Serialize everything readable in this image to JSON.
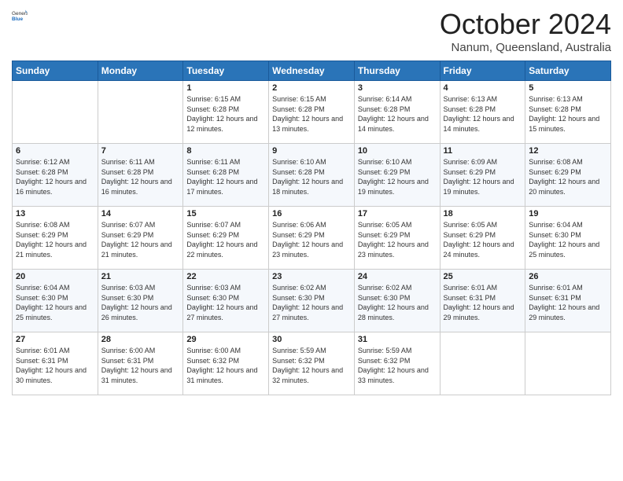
{
  "logo": {
    "general": "General",
    "blue": "Blue"
  },
  "title": "October 2024",
  "location": "Nanum, Queensland, Australia",
  "days_of_week": [
    "Sunday",
    "Monday",
    "Tuesday",
    "Wednesday",
    "Thursday",
    "Friday",
    "Saturday"
  ],
  "weeks": [
    [
      {
        "day": "",
        "info": ""
      },
      {
        "day": "",
        "info": ""
      },
      {
        "day": "1",
        "info": "Sunrise: 6:15 AM\nSunset: 6:28 PM\nDaylight: 12 hours and 12 minutes."
      },
      {
        "day": "2",
        "info": "Sunrise: 6:15 AM\nSunset: 6:28 PM\nDaylight: 12 hours and 13 minutes."
      },
      {
        "day": "3",
        "info": "Sunrise: 6:14 AM\nSunset: 6:28 PM\nDaylight: 12 hours and 14 minutes."
      },
      {
        "day": "4",
        "info": "Sunrise: 6:13 AM\nSunset: 6:28 PM\nDaylight: 12 hours and 14 minutes."
      },
      {
        "day": "5",
        "info": "Sunrise: 6:13 AM\nSunset: 6:28 PM\nDaylight: 12 hours and 15 minutes."
      }
    ],
    [
      {
        "day": "6",
        "info": "Sunrise: 6:12 AM\nSunset: 6:28 PM\nDaylight: 12 hours and 16 minutes."
      },
      {
        "day": "7",
        "info": "Sunrise: 6:11 AM\nSunset: 6:28 PM\nDaylight: 12 hours and 16 minutes."
      },
      {
        "day": "8",
        "info": "Sunrise: 6:11 AM\nSunset: 6:28 PM\nDaylight: 12 hours and 17 minutes."
      },
      {
        "day": "9",
        "info": "Sunrise: 6:10 AM\nSunset: 6:28 PM\nDaylight: 12 hours and 18 minutes."
      },
      {
        "day": "10",
        "info": "Sunrise: 6:10 AM\nSunset: 6:29 PM\nDaylight: 12 hours and 19 minutes."
      },
      {
        "day": "11",
        "info": "Sunrise: 6:09 AM\nSunset: 6:29 PM\nDaylight: 12 hours and 19 minutes."
      },
      {
        "day": "12",
        "info": "Sunrise: 6:08 AM\nSunset: 6:29 PM\nDaylight: 12 hours and 20 minutes."
      }
    ],
    [
      {
        "day": "13",
        "info": "Sunrise: 6:08 AM\nSunset: 6:29 PM\nDaylight: 12 hours and 21 minutes."
      },
      {
        "day": "14",
        "info": "Sunrise: 6:07 AM\nSunset: 6:29 PM\nDaylight: 12 hours and 21 minutes."
      },
      {
        "day": "15",
        "info": "Sunrise: 6:07 AM\nSunset: 6:29 PM\nDaylight: 12 hours and 22 minutes."
      },
      {
        "day": "16",
        "info": "Sunrise: 6:06 AM\nSunset: 6:29 PM\nDaylight: 12 hours and 23 minutes."
      },
      {
        "day": "17",
        "info": "Sunrise: 6:05 AM\nSunset: 6:29 PM\nDaylight: 12 hours and 23 minutes."
      },
      {
        "day": "18",
        "info": "Sunrise: 6:05 AM\nSunset: 6:29 PM\nDaylight: 12 hours and 24 minutes."
      },
      {
        "day": "19",
        "info": "Sunrise: 6:04 AM\nSunset: 6:30 PM\nDaylight: 12 hours and 25 minutes."
      }
    ],
    [
      {
        "day": "20",
        "info": "Sunrise: 6:04 AM\nSunset: 6:30 PM\nDaylight: 12 hours and 25 minutes."
      },
      {
        "day": "21",
        "info": "Sunrise: 6:03 AM\nSunset: 6:30 PM\nDaylight: 12 hours and 26 minutes."
      },
      {
        "day": "22",
        "info": "Sunrise: 6:03 AM\nSunset: 6:30 PM\nDaylight: 12 hours and 27 minutes."
      },
      {
        "day": "23",
        "info": "Sunrise: 6:02 AM\nSunset: 6:30 PM\nDaylight: 12 hours and 27 minutes."
      },
      {
        "day": "24",
        "info": "Sunrise: 6:02 AM\nSunset: 6:30 PM\nDaylight: 12 hours and 28 minutes."
      },
      {
        "day": "25",
        "info": "Sunrise: 6:01 AM\nSunset: 6:31 PM\nDaylight: 12 hours and 29 minutes."
      },
      {
        "day": "26",
        "info": "Sunrise: 6:01 AM\nSunset: 6:31 PM\nDaylight: 12 hours and 29 minutes."
      }
    ],
    [
      {
        "day": "27",
        "info": "Sunrise: 6:01 AM\nSunset: 6:31 PM\nDaylight: 12 hours and 30 minutes."
      },
      {
        "day": "28",
        "info": "Sunrise: 6:00 AM\nSunset: 6:31 PM\nDaylight: 12 hours and 31 minutes."
      },
      {
        "day": "29",
        "info": "Sunrise: 6:00 AM\nSunset: 6:32 PM\nDaylight: 12 hours and 31 minutes."
      },
      {
        "day": "30",
        "info": "Sunrise: 5:59 AM\nSunset: 6:32 PM\nDaylight: 12 hours and 32 minutes."
      },
      {
        "day": "31",
        "info": "Sunrise: 5:59 AM\nSunset: 6:32 PM\nDaylight: 12 hours and 33 minutes."
      },
      {
        "day": "",
        "info": ""
      },
      {
        "day": "",
        "info": ""
      }
    ]
  ]
}
